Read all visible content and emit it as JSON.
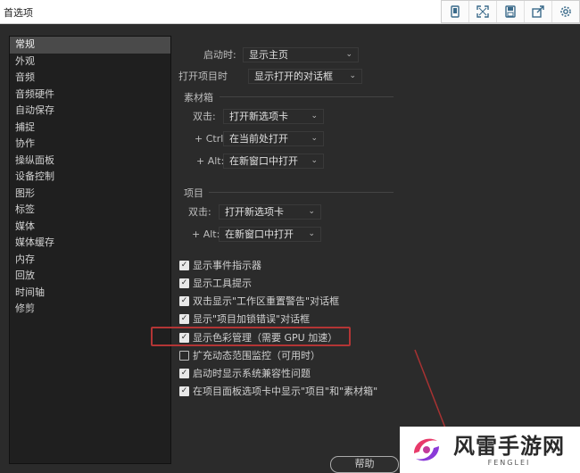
{
  "window": {
    "title": "首选项"
  },
  "toolbar": {
    "icons": [
      "phone-icon",
      "expand-icon",
      "save-icon",
      "share-icon",
      "gear-icon"
    ]
  },
  "sidebar": {
    "items": [
      {
        "label": "常规",
        "active": true
      },
      {
        "label": "外观"
      },
      {
        "label": "音频"
      },
      {
        "label": "音频硬件"
      },
      {
        "label": "自动保存"
      },
      {
        "label": "捕捉"
      },
      {
        "label": "协作"
      },
      {
        "label": "操纵面板"
      },
      {
        "label": "设备控制"
      },
      {
        "label": "图形"
      },
      {
        "label": "标签"
      },
      {
        "label": "媒体"
      },
      {
        "label": "媒体缓存"
      },
      {
        "label": "内存"
      },
      {
        "label": "回放"
      },
      {
        "label": "时间轴"
      },
      {
        "label": "修剪"
      }
    ]
  },
  "general": {
    "startup_label": "启动时:",
    "startup_value": "显示主页",
    "open_project_label": "打开项目时",
    "open_project_value": "显示打开的对话框"
  },
  "bins": {
    "title": "素材箱",
    "double_click_label": "双击:",
    "double_click_value": "打开新选项卡",
    "ctrl_label": "+ Ctrl:",
    "ctrl_value": "在当前处打开",
    "alt_label": "+ Alt:",
    "alt_value": "在新窗口中打开"
  },
  "project": {
    "title": "项目",
    "double_click_label": "双击:",
    "double_click_value": "打开新选项卡",
    "alt_label": "+ Alt:",
    "alt_value": "在新窗口中打开"
  },
  "checkboxes": [
    {
      "label": "显示事件指示器",
      "checked": true
    },
    {
      "label": "显示工具提示",
      "checked": true
    },
    {
      "label": "双击显示\"工作区重置警告\"对话框",
      "checked": true
    },
    {
      "label": "显示\"项目加锁错误\"对话框",
      "checked": true
    },
    {
      "label": "显示色彩管理（需要 GPU 加速）",
      "checked": true
    },
    {
      "label": "扩充动态范围监控（可用时）",
      "checked": false
    },
    {
      "label": "启动时显示系统兼容性问题",
      "checked": true
    },
    {
      "label": "在项目面板选项卡中显示\"项目\"和\"素材箱\"",
      "checked": true
    }
  ],
  "footer": {
    "help_label": "帮助"
  },
  "watermark": {
    "text": "风雷手游网",
    "subtext": "FENGLEI"
  },
  "colors": {
    "highlight": "#b33535",
    "background": "#2b2b2b"
  }
}
